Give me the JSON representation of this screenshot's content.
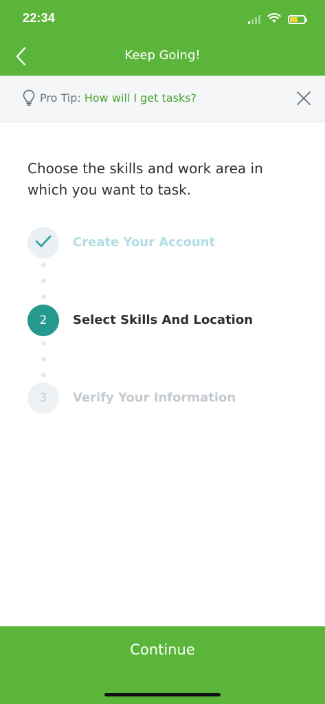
{
  "status_bar": {
    "time": "22:34",
    "icons": [
      "signal-icon",
      "wifi-icon",
      "battery-icon"
    ],
    "battery_color": "#f4d63a"
  },
  "nav": {
    "title": "Keep Going!",
    "back_icon": "chevron-left-icon"
  },
  "pro_tip": {
    "prefix": "Pro Tip: ",
    "link": "How will I get tasks?",
    "icon": "lightbulb-icon",
    "close_icon": "close-icon"
  },
  "intro": "Choose the skills and work area in which you want to task.",
  "steps": [
    {
      "number": "✓",
      "label": "Create Your Account",
      "state": "done"
    },
    {
      "number": "2",
      "label": "Select Skills And Location",
      "state": "active"
    },
    {
      "number": "3",
      "label": "Verify Your Information",
      "state": "todo"
    }
  ],
  "continue_label": "Continue",
  "colors": {
    "brand_green": "#5bb53a",
    "link_green": "#4aa32f",
    "active_step_teal": "#26998f",
    "done_step_text": "#b0dde2"
  }
}
